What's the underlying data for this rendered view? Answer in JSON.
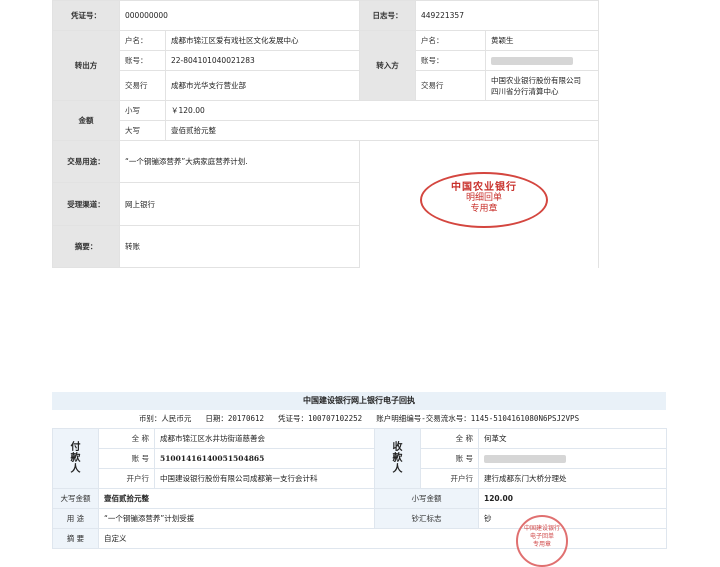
{
  "receipt1": {
    "voucher_label": "凭证号：",
    "voucher_value": "000000000",
    "log_label": "日志号：",
    "log_value": "449221357",
    "out_label": "转出方",
    "in_label": "转入方",
    "name_label": "户名：",
    "acct_label": "账号：",
    "bank_label": "交易行",
    "out_name": "成都市锦江区爱有戏社区文化发展中心",
    "out_acct": "22-804101040021283",
    "out_bank": "成都市光华支行营业部",
    "in_name": "黄颖生",
    "in_bank_line1": "中国农业银行股份有限公司",
    "in_bank_line2": "四川省分行清算中心",
    "amount_label": "金额",
    "small_label": "小写",
    "small_value": "￥120.00",
    "big_label": "大写",
    "big_value": "壹佰贰拾元整",
    "purpose_label": "交易用途：",
    "purpose_value": "“一个钢镚添营养”大病家庭营养计划.",
    "channel_label": "受理渠道：",
    "channel_value": "网上银行",
    "summary_label": "摘要：",
    "summary_value": "转账",
    "seal_line1": "中国农业银行",
    "seal_line2": "明细回单",
    "seal_line3": "专用章"
  },
  "receipt2": {
    "title": "中国建设银行网上银行电子回执",
    "currency_label": "币别：",
    "currency_value": "人民币元",
    "date_label": "日期：",
    "date_value": "20170612",
    "voucher_label": "凭证号：",
    "voucher_value": "100707102252",
    "serial_label": "账户明细编号-交易流水号：",
    "serial_value": "1145-5104161080N6PSJ2VPS",
    "payer_label": "付\n款\n人",
    "payee_label": "收\n款\n人",
    "full_name_label": "全 称",
    "acct_label": "账 号",
    "bank_label": "开户行",
    "payer_name": "成都市锦江区水井坊街道慈善会",
    "payer_acct": "51001416140051504865",
    "payer_bank": "中国建设银行股份有限公司成都第一支行会计科",
    "payee_name": "何革文",
    "payee_bank": "建行成都东门大桥分理处",
    "big_amount_label": "大写金额",
    "big_amount_value": "壹佰贰拾元整",
    "small_amount_label": "小写金额",
    "small_amount_value": "120.00",
    "use_label": "用 途",
    "use_value": "“一个钢镚添营养”计划受援",
    "cash_label": "钞汇标志",
    "cash_value": "钞",
    "summary_label": "摘 要",
    "summary_value": "自定义",
    "seal_line1": "中国建设银行",
    "seal_line2": "电子回单",
    "seal_line3": "专用章"
  }
}
